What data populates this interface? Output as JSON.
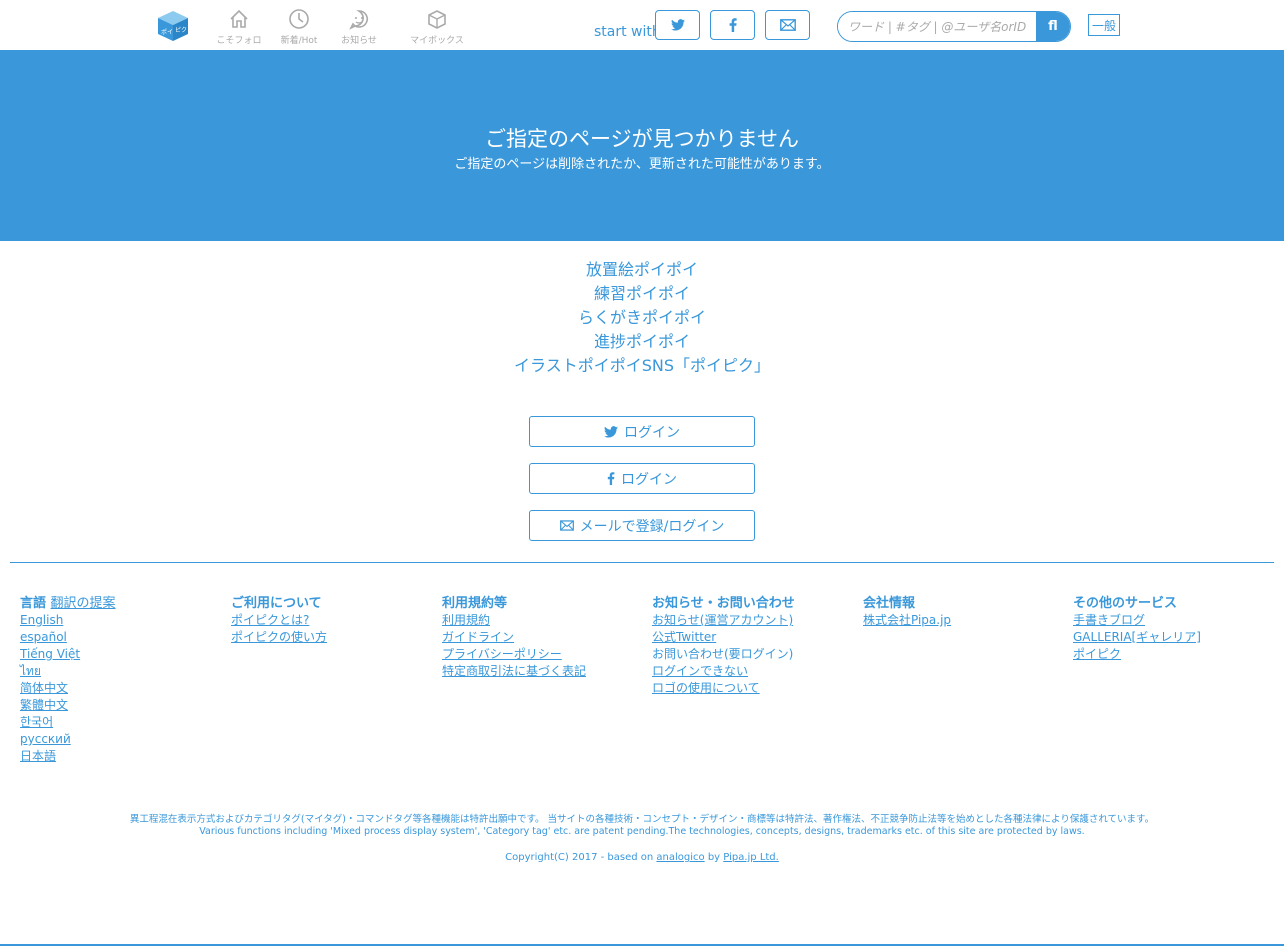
{
  "header": {
    "nav": [
      {
        "label": "こそフォロ"
      },
      {
        "label": "新着/Hot"
      },
      {
        "label": "お知らせ"
      },
      {
        "label": "マイボックス"
      }
    ],
    "start_with": "start with",
    "search": {
      "placeholder": "ワード | #タグ | @ユーザ名orID",
      "button": "fl"
    },
    "lang_button": "一般"
  },
  "hero": {
    "title": "ご指定のページが見つかりません",
    "subtitle": "ご指定のページは削除されたか、更新された可能性があります。"
  },
  "tags": [
    "放置絵ポイポイ",
    "練習ポイポイ",
    "らくがきポイポイ",
    "進捗ポイポイ",
    "イラストポイポイSNS「ポイピク」"
  ],
  "login": {
    "twitter": "ログイン",
    "facebook": "ログイン",
    "email": "メールで登録/ログイン"
  },
  "footer": {
    "language": {
      "prefix": "言語",
      "title_link": "翻訳の提案",
      "links": [
        "English",
        "español",
        "Tiếng Việt",
        "ไทย",
        "简体中文",
        "繁體中文",
        "한국어",
        "русский",
        "日本語"
      ]
    },
    "about": {
      "title": "ご利用について",
      "links": [
        "ポイピクとは?",
        "ポイピクの使い方"
      ]
    },
    "terms": {
      "title": "利用規約等",
      "links": [
        "利用規約",
        "ガイドライン",
        "プライバシーポリシー",
        "特定商取引法に基づく表記"
      ]
    },
    "news": {
      "title": "お知らせ・お問い合わせ",
      "links": [
        "お知らせ(運営アカウント)",
        "公式Twitter"
      ],
      "text": "お問い合わせ(要ログイン)",
      "links2": [
        "ログインできない",
        "ロゴの使用について"
      ]
    },
    "company": {
      "title": "会社情報",
      "links": [
        "株式会社Pipa.jp"
      ]
    },
    "services": {
      "title": "その他のサービス",
      "links": [
        "手書きブログ",
        "GALLERIA[ギャレリア]",
        "ポイピク"
      ]
    }
  },
  "legal": {
    "ja": "異工程混在表示方式およびカテゴリタグ(マイタグ)・コマンドタグ等各種機能は特許出願中です。 当サイトの各種技術・コンセプト・デザイン・商標等は特許法、著作権法、不正競争防止法等を始めとした各種法律により保護されています。",
    "en": "Various functions including 'Mixed process display system', 'Category tag' etc. are patent pending.The technologies, concepts, designs, trademarks etc. of this site are protected by laws."
  },
  "copyright": {
    "prefix": "Copyright(C) 2017 - based on ",
    "link1": "analogico",
    "mid": " by ",
    "link2": "Pipa.jp Ltd."
  },
  "colors": {
    "accent": "#3a98da",
    "nav_gray": "#aaaaaa"
  }
}
